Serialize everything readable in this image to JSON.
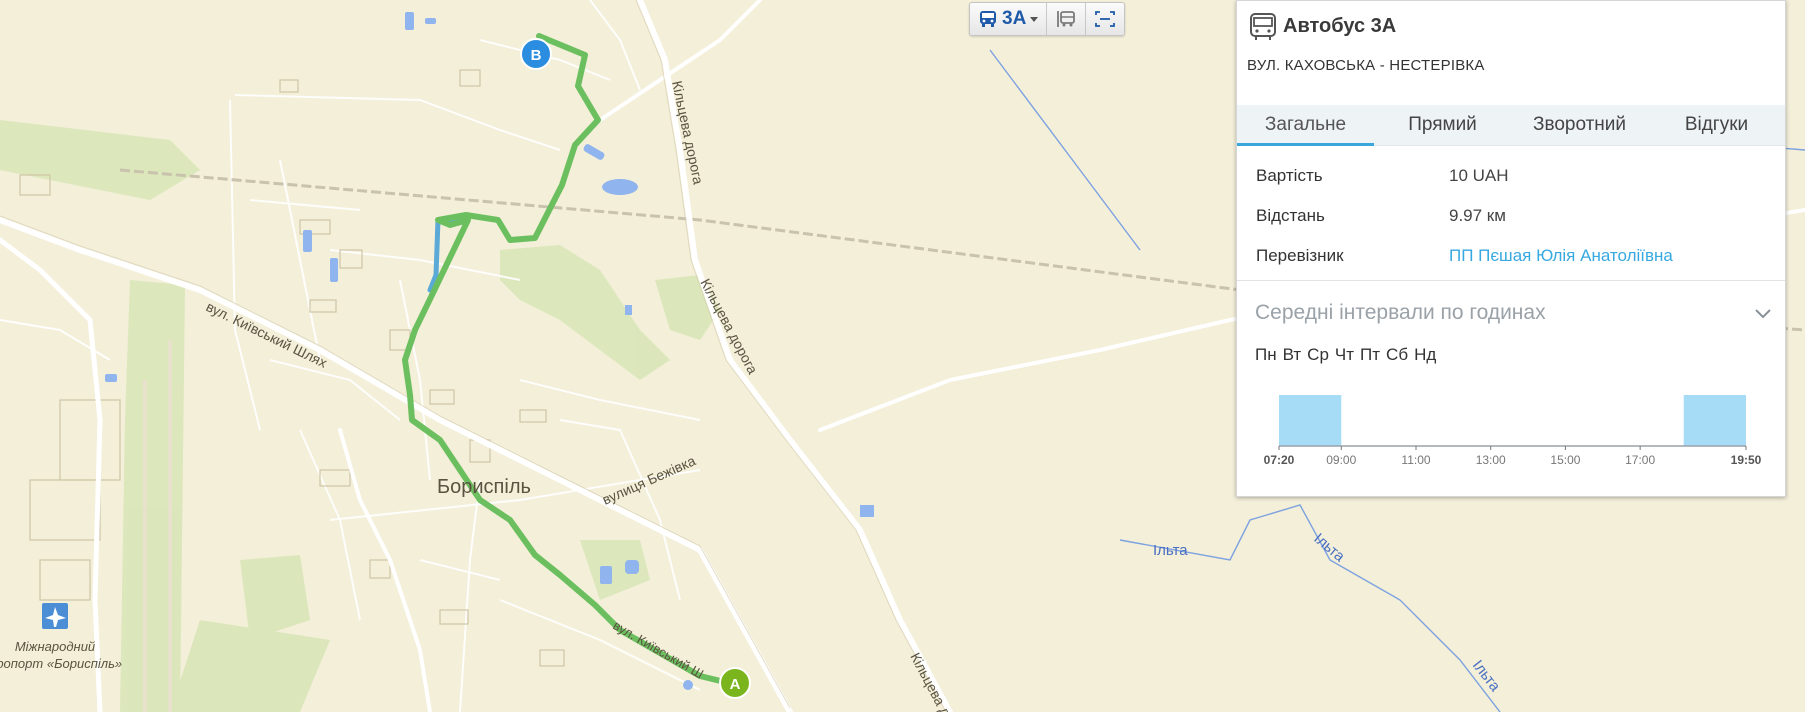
{
  "map": {
    "labels": {
      "city": "Бориспіль",
      "airport_line1": "Міжнародний",
      "airport_line2": "аеропорт «Бориспіль»",
      "street_kyivsky_shlyakh": "вул. Київський Шлях",
      "street_bezhivka": "вулиця Бежівка",
      "ring_road_1": "Кільцева дорога",
      "ring_road_2": "Кільцева дорога",
      "ring_road_3": "Кільцева д",
      "street_kyivsky_lower": "вул. Київський Ш",
      "river_1": "Ільта",
      "river_2": "Ільта",
      "river_3": "Ільта"
    },
    "markers": {
      "start": "A",
      "end": "B"
    },
    "colors": {
      "route_forward": "#6cbf5e",
      "route_backward": "#5aa9d6",
      "marker_a": "#7ab51d",
      "marker_b": "#2a8de0"
    }
  },
  "toolbar": {
    "route_number": "3А",
    "icons": [
      "bus-icon",
      "stops-icon",
      "fit-route-icon"
    ]
  },
  "panel": {
    "title": "Автобус 3А",
    "subtitle": "ВУЛ. КАХОВСЬКА - НЕСТЕРІВКА",
    "tabs": [
      "Загальне",
      "Прямий",
      "Зворотний",
      "Відгуки"
    ],
    "active_tab": "Загальне",
    "info": [
      {
        "key": "Вартість",
        "value": "10 UAH"
      },
      {
        "key": "Відстань",
        "value": "9.97 км"
      },
      {
        "key": "Перевізник",
        "value": "ПП Пєшая Юлія Анатоліївна"
      }
    ],
    "intervals_title": "Середні інтервали по годинах",
    "days": [
      "Пн",
      "Вт",
      "Ср",
      "Чт",
      "Пт",
      "Сб",
      "Нд"
    ]
  },
  "chart_data": {
    "type": "bar",
    "x_start_label": "07:20",
    "x_end_label": "19:50",
    "tick_labels": [
      "09:00",
      "11:00",
      "13:00",
      "15:00",
      "17:00"
    ],
    "x_range_minutes": [
      440,
      1190
    ],
    "bars": [
      {
        "start": "07:20",
        "end": "09:00"
      },
      {
        "start": "18:10",
        "end": "19:50"
      }
    ],
    "bar_color": "#a6dcf5"
  }
}
